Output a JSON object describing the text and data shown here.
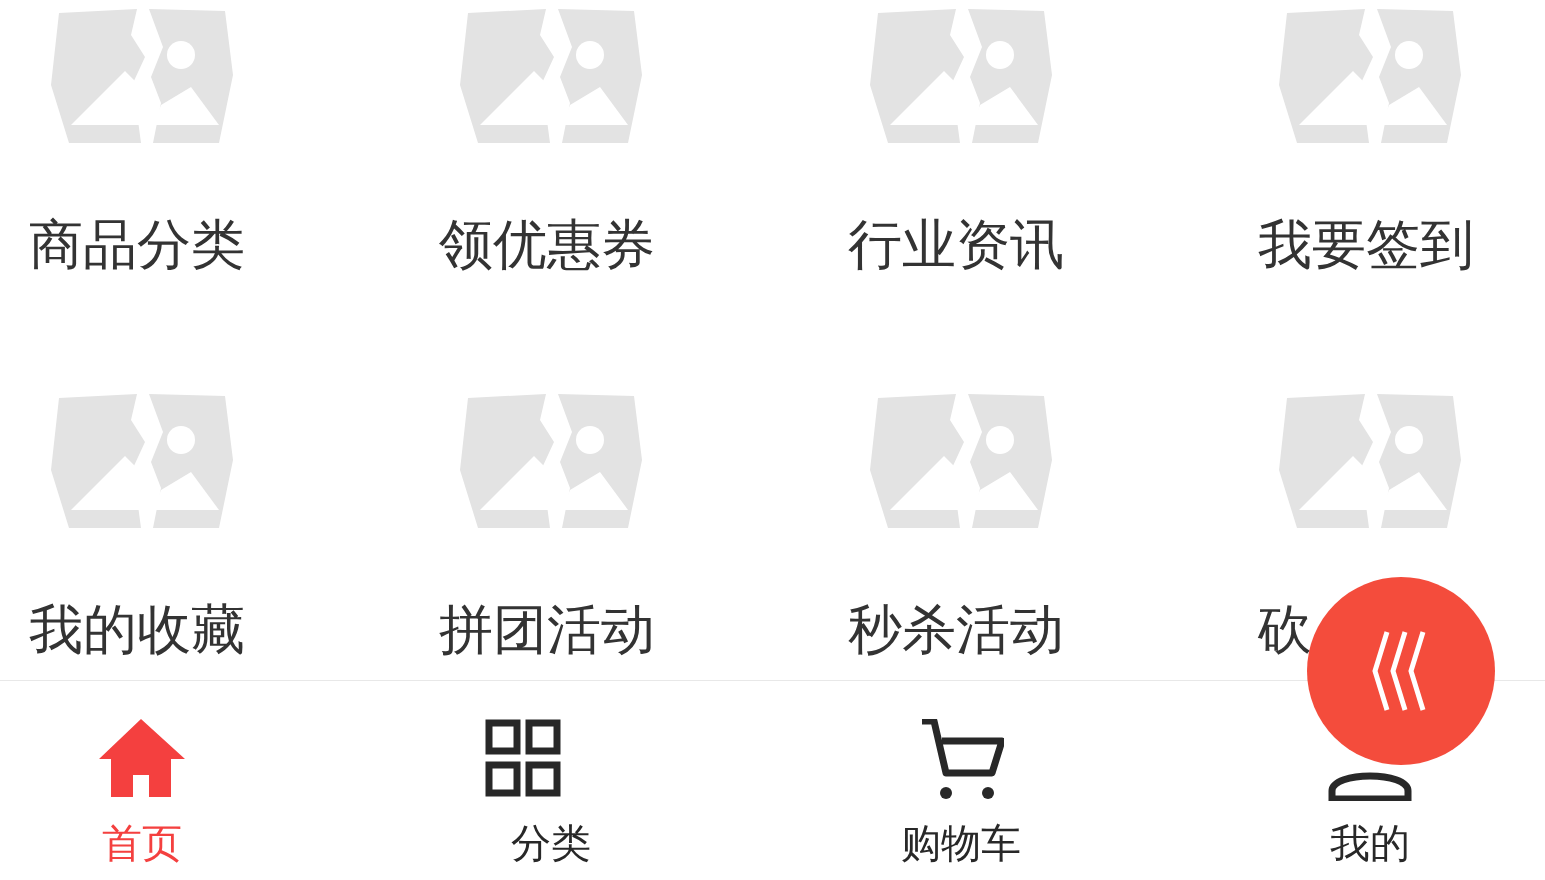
{
  "menu_items": [
    {
      "label": "商品分类"
    },
    {
      "label": "领优惠券"
    },
    {
      "label": "行业资讯"
    },
    {
      "label": "我要签到"
    },
    {
      "label": "我的收藏"
    },
    {
      "label": "拼团活动"
    },
    {
      "label": "秒杀活动"
    },
    {
      "label": "砍"
    }
  ],
  "tab_bar": [
    {
      "kind": "home",
      "label": "首页",
      "selected": true
    },
    {
      "kind": "grid",
      "label": "分类",
      "selected": false
    },
    {
      "kind": "cart",
      "label": "购物车",
      "selected": false
    },
    {
      "kind": "person",
      "label": "我的",
      "selected": false
    }
  ]
}
